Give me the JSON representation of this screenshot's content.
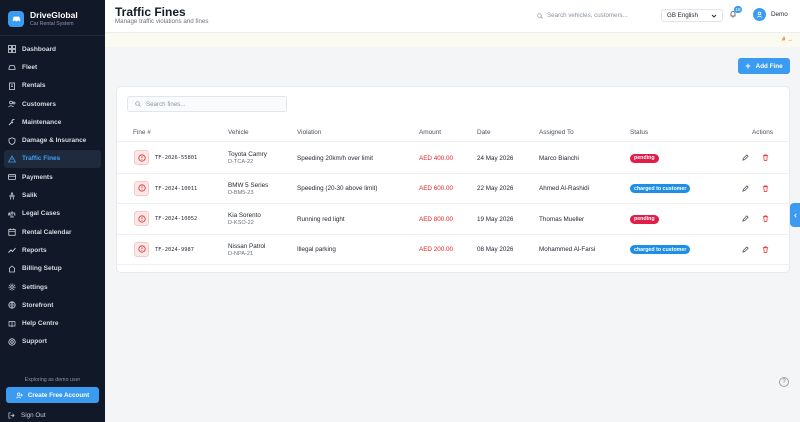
{
  "brand": {
    "name": "DriveGlobal",
    "subtitle": "Car Rental System"
  },
  "sidebar": {
    "items": [
      {
        "label": "Dashboard",
        "icon": "dashboard-icon"
      },
      {
        "label": "Fleet",
        "icon": "car-icon"
      },
      {
        "label": "Rentals",
        "icon": "clipboard-icon"
      },
      {
        "label": "Customers",
        "icon": "users-icon"
      },
      {
        "label": "Maintenance",
        "icon": "wrench-icon"
      },
      {
        "label": "Damage & Insurance",
        "icon": "shield-icon"
      },
      {
        "label": "Traffic Fines",
        "icon": "alert-triangle-icon",
        "active": true
      },
      {
        "label": "Payments",
        "icon": "credit-card-icon"
      },
      {
        "label": "Salik",
        "icon": "road-icon"
      },
      {
        "label": "Legal Cases",
        "icon": "scale-icon"
      },
      {
        "label": "Rental Calendar",
        "icon": "calendar-icon"
      },
      {
        "label": "Reports",
        "icon": "trend-icon"
      },
      {
        "label": "Billing Setup",
        "icon": "billing-icon"
      },
      {
        "label": "Settings",
        "icon": "gear-icon"
      },
      {
        "label": "Storefront",
        "icon": "globe-icon"
      },
      {
        "label": "Help Centre",
        "icon": "book-icon"
      },
      {
        "label": "Support",
        "icon": "lifebuoy-icon"
      }
    ],
    "demo_note": "Exploring as demo user",
    "cta_label": "Create Free Account",
    "signout_label": "Sign Out"
  },
  "header": {
    "title": "Traffic Fines",
    "subtitle": "Manage traffic violations and fines",
    "search_placeholder": "Search vehicles, customers...",
    "language": "GB English",
    "notification_count": "18",
    "user_name": "Demo"
  },
  "notice": {
    "arrow": "# →"
  },
  "add_button_label": "Add Fine",
  "table": {
    "search_placeholder": "Search fines...",
    "headers": [
      "Fine #",
      "Vehicle",
      "Violation",
      "Amount",
      "Date",
      "Assigned To",
      "Status",
      "Actions"
    ],
    "rows": [
      {
        "fine": "TF-2026-55801",
        "vehicle": "Toyota Camry",
        "plate": "D-TCA-22",
        "violation": "Speeding 20km/h over limit",
        "amount": "AED 400.00",
        "date": "24 May 2026",
        "assigned": "Marco Bianchi",
        "status": "pending"
      },
      {
        "fine": "TF-2024-10011",
        "vehicle": "BMW 5 Series",
        "plate": "D-BM5-23",
        "violation": "Speeding (20-30 above limit)",
        "amount": "AED 600.00",
        "date": "22 May 2026",
        "assigned": "Ahmed Al-Rashidi",
        "status": "charged to customer"
      },
      {
        "fine": "TF-2024-10052",
        "vehicle": "Kia Sorento",
        "plate": "D-KSO-22",
        "violation": "Running red light",
        "amount": "AED 800.00",
        "date": "19 May 2026",
        "assigned": "Thomas Mueller",
        "status": "pending"
      },
      {
        "fine": "TF-2024-9987",
        "vehicle": "Nissan Patrol",
        "plate": "D-NPA-21",
        "violation": "Illegal parking",
        "amount": "AED 200.00",
        "date": "08 May 2026",
        "assigned": "Mohammed Al-Farsi",
        "status": "charged to customer"
      }
    ]
  },
  "colors": {
    "accent": "#3b9bf0",
    "sidebar_bg": "#111827",
    "danger": "#dc2626",
    "pending": "#e11d48",
    "charged": "#1f8fe6"
  },
  "help_glyph": "?"
}
